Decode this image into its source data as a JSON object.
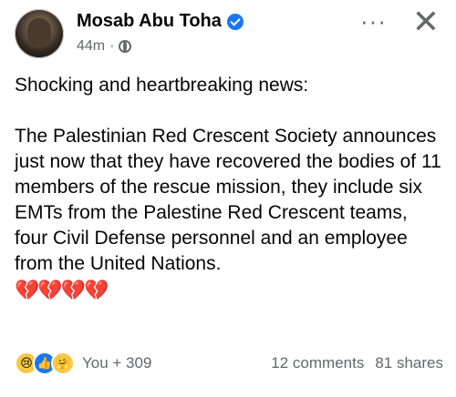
{
  "post": {
    "author": "Mosab Abu Toha",
    "time": "44m",
    "dot": "·",
    "paragraph1": "Shocking and heartbreaking news:",
    "paragraph2": "The Palestinian Red Crescent Society announces just now that they have recovered the bodies of 11 members of the rescue mission, they include six EMTs from the Palestine Red Crescent teams, four Civil Defense personnel and an employee from the United Nations.",
    "hearts": "💔💔💔💔"
  },
  "header": {
    "more_label": "···",
    "close_label": "✕"
  },
  "footer": {
    "reactions": [
      "sad-reaction",
      "like-reaction",
      "care-reaction"
    ],
    "reaction_summary": "You + 309",
    "comments": "12 comments",
    "shares": "81 shares"
  },
  "colors": {
    "accent": "#1877f2",
    "secondary_text": "#65676b",
    "primary_text": "#050505"
  }
}
